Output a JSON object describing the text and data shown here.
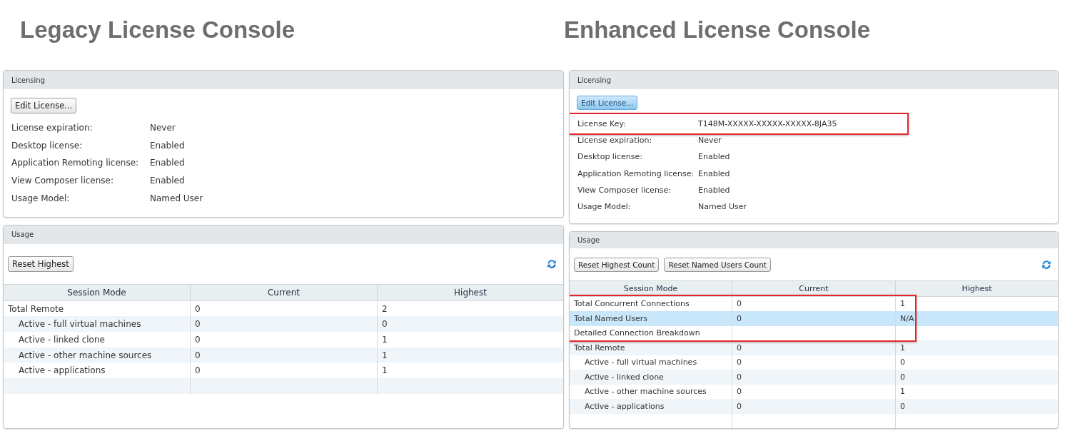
{
  "consoles": [
    {
      "title": "Legacy License Console",
      "kind": "legacy",
      "licensing": {
        "title": "Licensing",
        "button": {
          "label": "Edit License...",
          "hovered": false
        },
        "rows": [
          {
            "label": "License expiration:",
            "value": "Never",
            "highlighted": false
          },
          {
            "label": "Desktop license:",
            "value": "Enabled",
            "highlighted": false
          },
          {
            "label": "Application Remoting license:",
            "value": "Enabled",
            "highlighted": false
          },
          {
            "label": "View Composer license:",
            "value": "Enabled",
            "highlighted": false
          },
          {
            "label": "Usage Model:",
            "value": "Named User",
            "highlighted": false
          }
        ]
      },
      "usage": {
        "title": "Usage",
        "buttons": [
          {
            "label": "Reset Highest"
          }
        ],
        "columns": [
          "Session Mode",
          "Current",
          "Highest"
        ],
        "rows": [
          {
            "cells": [
              "Total Remote",
              "0",
              "2"
            ],
            "selected": false,
            "highlighted": false,
            "children": [
              {
                "cells": [
                  "Active - full virtual machines",
                  "0",
                  "0"
                ],
                "selected": false,
                "highlighted": false
              },
              {
                "cells": [
                  "Active - linked clone",
                  "0",
                  "1"
                ],
                "selected": false,
                "highlighted": false
              },
              {
                "cells": [
                  "Active - other machine sources",
                  "0",
                  "1"
                ],
                "selected": false,
                "highlighted": false
              },
              {
                "cells": [
                  "Active - applications",
                  "0",
                  "1"
                ],
                "selected": false,
                "highlighted": false
              }
            ]
          }
        ]
      }
    },
    {
      "title": "Enhanced License Console",
      "kind": "enhanced",
      "licensing": {
        "title": "Licensing",
        "button": {
          "label": "Edit License...",
          "hovered": true
        },
        "rows": [
          {
            "label": "License Key:",
            "value": "T148M-XXXXX-XXXXX-XXXXX-8JA35",
            "highlighted": true
          },
          {
            "label": "License expiration:",
            "value": "Never",
            "highlighted": false
          },
          {
            "label": "Desktop license:",
            "value": "Enabled",
            "highlighted": false
          },
          {
            "label": "Application Remoting license:",
            "value": "Enabled",
            "highlighted": false
          },
          {
            "label": "View Composer license:",
            "value": "Enabled",
            "highlighted": false
          },
          {
            "label": "Usage Model:",
            "value": "Named User",
            "highlighted": false
          }
        ]
      },
      "usage": {
        "title": "Usage",
        "buttons": [
          {
            "label": "Reset Highest Count"
          },
          {
            "label": "Reset Named Users Count"
          }
        ],
        "columns": [
          "Session Mode",
          "Current",
          "Highest"
        ],
        "rows": [
          {
            "cells": [
              "Total Concurrent Connections",
              "0",
              "1"
            ],
            "selected": false,
            "highlighted": true
          },
          {
            "cells": [
              "Total Named Users",
              "0",
              "N/A"
            ],
            "selected": true,
            "highlighted": true
          },
          {
            "cells": [
              "Detailed Connection Breakdown"
            ],
            "selected": false,
            "highlighted": true
          },
          {
            "cells": [
              "Total Remote",
              "0",
              "1"
            ],
            "selected": false,
            "highlighted": false,
            "children": [
              {
                "cells": [
                  "Active - full virtual machines",
                  "0",
                  "0"
                ],
                "selected": false,
                "highlighted": false
              },
              {
                "cells": [
                  "Active - linked clone",
                  "0",
                  "0"
                ],
                "selected": false,
                "highlighted": false
              },
              {
                "cells": [
                  "Active - other machine sources",
                  "0",
                  "1"
                ],
                "selected": false,
                "highlighted": false
              },
              {
                "cells": [
                  "Active - applications",
                  "0",
                  "0"
                ],
                "selected": false,
                "highlighted": false
              }
            ]
          }
        ]
      }
    }
  ]
}
